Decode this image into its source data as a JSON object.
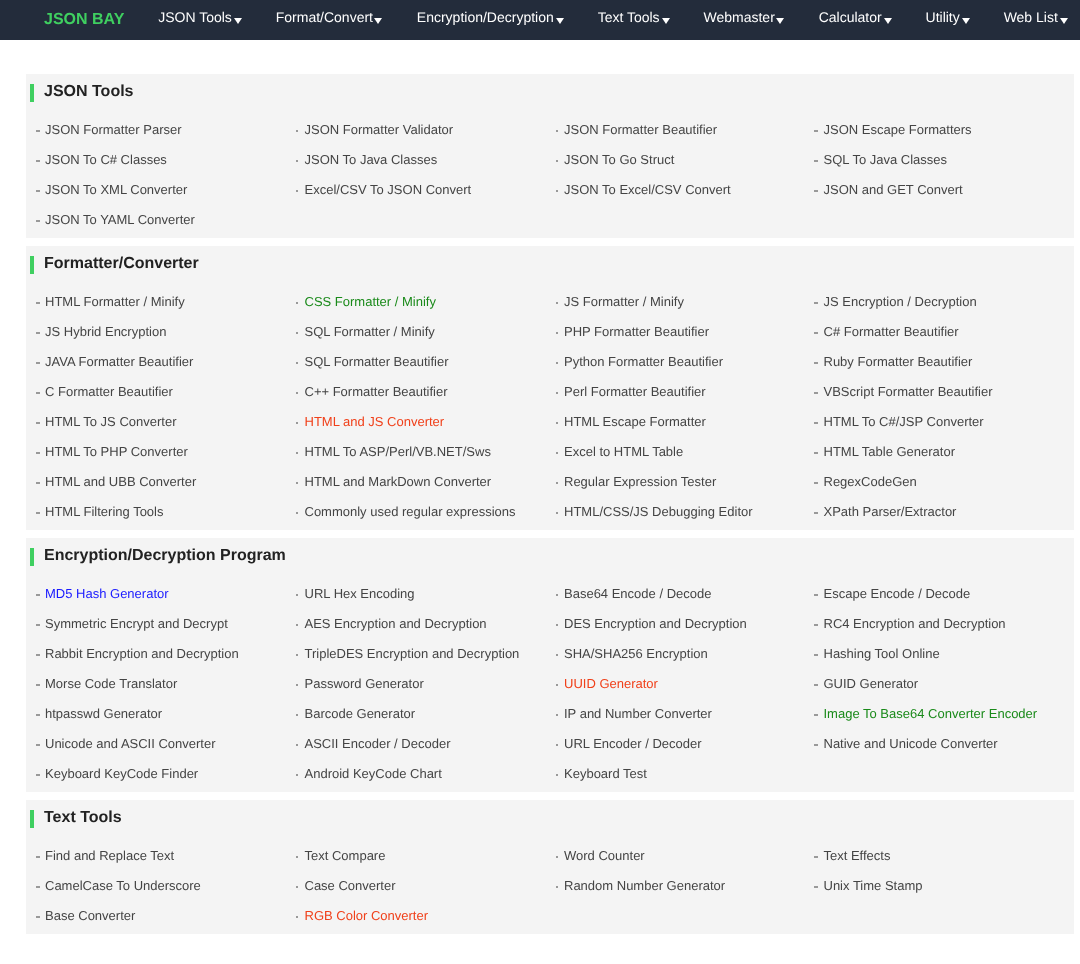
{
  "nav": {
    "logo": "JSON BAY",
    "items": [
      "JSON Tools",
      "Format/Convert",
      "Encryption/Decryption",
      "Text Tools",
      "Webmaster",
      "Calculator",
      "Utility",
      "Web List"
    ]
  },
  "sections": [
    {
      "title": "JSON Tools",
      "links": [
        {
          "text": "JSON Formatter Parser"
        },
        {
          "text": "JSON Formatter Validator"
        },
        {
          "text": "JSON Formatter Beautifier"
        },
        {
          "text": "JSON Escape Formatters"
        },
        {
          "text": "JSON To C# Classes"
        },
        {
          "text": "JSON To Java Classes"
        },
        {
          "text": "JSON To Go Struct"
        },
        {
          "text": "SQL To Java Classes"
        },
        {
          "text": "JSON To XML Converter"
        },
        {
          "text": "Excel/CSV To JSON Convert"
        },
        {
          "text": "JSON To Excel/CSV Convert"
        },
        {
          "text": "JSON and GET Convert"
        },
        {
          "text": "JSON To YAML Converter"
        }
      ]
    },
    {
      "title": "Formatter/Converter",
      "links": [
        {
          "text": "HTML Formatter / Minify"
        },
        {
          "text": "CSS Formatter / Minify",
          "color": "#1a8a1a"
        },
        {
          "text": "JS Formatter / Minify"
        },
        {
          "text": "JS Encryption / Decryption"
        },
        {
          "text": "JS Hybrid Encryption"
        },
        {
          "text": "SQL Formatter / Minify"
        },
        {
          "text": "PHP Formatter Beautifier"
        },
        {
          "text": "C# Formatter Beautifier"
        },
        {
          "text": "JAVA Formatter Beautifier"
        },
        {
          "text": "SQL Formatter Beautifier"
        },
        {
          "text": "Python Formatter Beautifier"
        },
        {
          "text": "Ruby Formatter Beautifier"
        },
        {
          "text": "C Formatter Beautifier"
        },
        {
          "text": "C++ Formatter Beautifier"
        },
        {
          "text": "Perl Formatter Beautifier"
        },
        {
          "text": "VBScript Formatter Beautifier"
        },
        {
          "text": "HTML To JS Converter"
        },
        {
          "text": "HTML and JS Converter",
          "color": "#f0401a"
        },
        {
          "text": "HTML Escape Formatter"
        },
        {
          "text": "HTML To C#/JSP Converter"
        },
        {
          "text": "HTML To PHP Converter"
        },
        {
          "text": "HTML To ASP/Perl/VB.NET/Sws"
        },
        {
          "text": "Excel to HTML Table"
        },
        {
          "text": "HTML Table Generator"
        },
        {
          "text": "HTML and UBB Converter"
        },
        {
          "text": "HTML and MarkDown Converter"
        },
        {
          "text": "Regular Expression Tester"
        },
        {
          "text": "RegexCodeGen"
        },
        {
          "text": "HTML Filtering Tools"
        },
        {
          "text": "Commonly used regular expressions"
        },
        {
          "text": "HTML/CSS/JS Debugging Editor"
        },
        {
          "text": "XPath Parser/Extractor"
        }
      ]
    },
    {
      "title": "Encryption/Decryption Program",
      "links": [
        {
          "text": "MD5 Hash Generator",
          "color": "#1a1aff"
        },
        {
          "text": "URL Hex Encoding"
        },
        {
          "text": "Base64 Encode / Decode"
        },
        {
          "text": "Escape Encode / Decode"
        },
        {
          "text": "Symmetric Encrypt and Decrypt"
        },
        {
          "text": "AES Encryption and Decryption"
        },
        {
          "text": "DES Encryption and Decryption"
        },
        {
          "text": "RC4 Encryption and Decryption"
        },
        {
          "text": "Rabbit Encryption and Decryption"
        },
        {
          "text": "TripleDES Encryption and Decryption"
        },
        {
          "text": "SHA/SHA256 Encryption"
        },
        {
          "text": "Hashing Tool Online"
        },
        {
          "text": "Morse Code Translator"
        },
        {
          "text": "Password Generator"
        },
        {
          "text": "UUID Generator",
          "color": "#f0401a"
        },
        {
          "text": "GUID Generator"
        },
        {
          "text": "htpasswd Generator"
        },
        {
          "text": "Barcode Generator"
        },
        {
          "text": "IP and Number Converter"
        },
        {
          "text": "Image To Base64 Converter Encoder",
          "color": "#1a8a1a"
        },
        {
          "text": "Unicode and ASCII Converter"
        },
        {
          "text": "ASCII Encoder / Decoder"
        },
        {
          "text": "URL Encoder / Decoder"
        },
        {
          "text": "Native and Unicode Converter"
        },
        {
          "text": "Keyboard KeyCode Finder"
        },
        {
          "text": "Android KeyCode Chart"
        },
        {
          "text": "Keyboard Test"
        }
      ]
    },
    {
      "title": "Text Tools",
      "links": [
        {
          "text": "Find and Replace Text"
        },
        {
          "text": "Text Compare"
        },
        {
          "text": "Word Counter"
        },
        {
          "text": "Text Effects"
        },
        {
          "text": "CamelCase To Underscore"
        },
        {
          "text": "Case Converter"
        },
        {
          "text": "Random Number Generator"
        },
        {
          "text": "Unix Time Stamp"
        },
        {
          "text": "Base Converter"
        },
        {
          "text": "RGB Color Converter",
          "color": "#f0401a"
        }
      ]
    }
  ]
}
